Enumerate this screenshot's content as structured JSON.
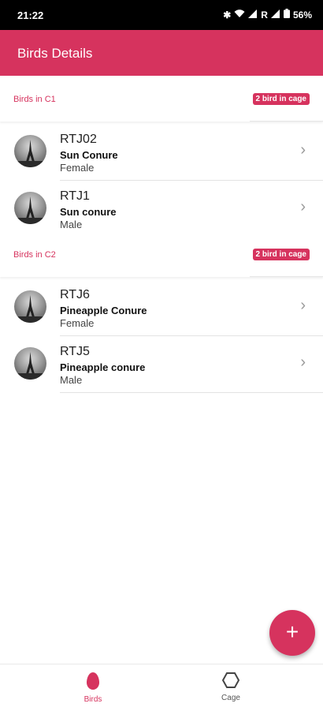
{
  "status_bar": {
    "time": "21:22",
    "carrier": "R",
    "battery": "56%"
  },
  "app_bar": {
    "title": "Birds Details"
  },
  "sections": [
    {
      "label": "Birds in C1",
      "badge": "2 bird in cage",
      "birds": [
        {
          "id": "RTJ02",
          "species": "Sun Conure",
          "gender": "Female"
        },
        {
          "id": "RTJ1",
          "species": "Sun conure",
          "gender": "Male"
        }
      ]
    },
    {
      "label": "Birds in C2",
      "badge": "2 bird in cage",
      "birds": [
        {
          "id": "RTJ6",
          "species": "Pineapple Conure",
          "gender": "Female"
        },
        {
          "id": "RTJ5",
          "species": "Pineapple conure",
          "gender": "Male"
        }
      ]
    }
  ],
  "fab": {
    "icon": "plus-icon",
    "label": "+"
  },
  "bottom_nav": [
    {
      "label": "Birds",
      "icon": "egg-icon",
      "active": true
    },
    {
      "label": "Cage",
      "icon": "hexagon-icon",
      "active": false
    }
  ],
  "colors": {
    "accent": "#d6335e",
    "inactive": "#555555"
  }
}
